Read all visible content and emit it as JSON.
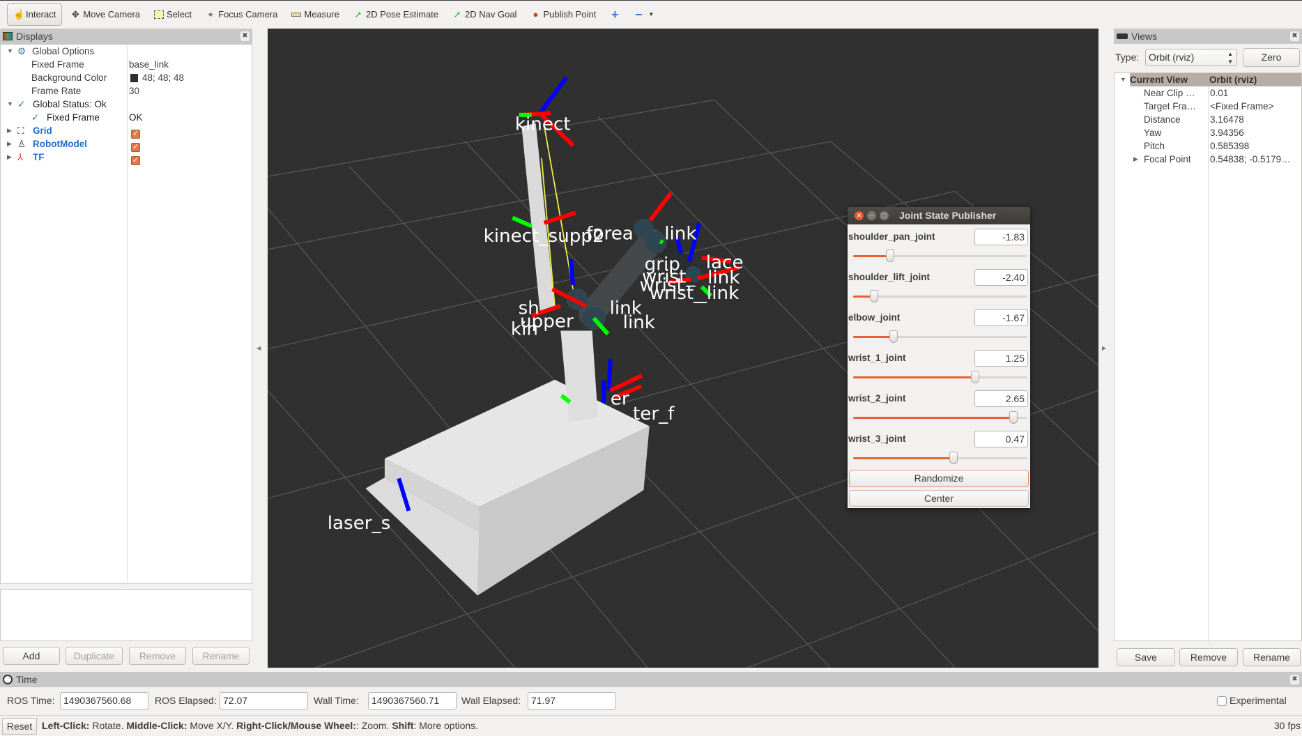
{
  "toolbar": {
    "items": [
      {
        "label": "Interact",
        "icon": "hand-pointer-icon",
        "active": true
      },
      {
        "label": "Move Camera",
        "icon": "move-camera-icon"
      },
      {
        "label": "Select",
        "icon": "select-rect-icon"
      },
      {
        "label": "Focus Camera",
        "icon": "focus-camera-icon"
      },
      {
        "label": "Measure",
        "icon": "ruler-icon"
      },
      {
        "label": "2D Pose Estimate",
        "icon": "green-arrow-icon"
      },
      {
        "label": "2D Nav Goal",
        "icon": "green-arrow-icon"
      },
      {
        "label": "Publish Point",
        "icon": "map-pin-icon"
      }
    ]
  },
  "displays": {
    "title": "Displays",
    "global_options": "Global Options",
    "fixed_frame_label": "Fixed Frame",
    "fixed_frame_value": "base_link",
    "bg_color_label": "Background Color",
    "bg_color_value": "48; 48; 48",
    "bg_color_swatch": "#303030",
    "frame_rate_label": "Frame Rate",
    "frame_rate_value": "30",
    "global_status": "Global Status: Ok",
    "status_fixed_frame_label": "Fixed Frame",
    "status_fixed_frame_value": "OK",
    "items": [
      {
        "label": "Grid",
        "checked": true
      },
      {
        "label": "RobotModel",
        "checked": true
      },
      {
        "label": "TF",
        "checked": true
      }
    ],
    "buttons": {
      "add": "Add",
      "duplicate": "Duplicate",
      "remove": "Remove",
      "rename": "Rename"
    }
  },
  "views": {
    "title": "Views",
    "type_label": "Type:",
    "type_value": "Orbit (rviz)",
    "zero": "Zero",
    "current_view": "Current View",
    "current_view_value": "Orbit (rviz)",
    "props": [
      {
        "label": "Near Clip …",
        "value": "0.01"
      },
      {
        "label": "Target Fra…",
        "value": "<Fixed Frame>"
      },
      {
        "label": "Distance",
        "value": "3.16478"
      },
      {
        "label": "Yaw",
        "value": "3.94356"
      },
      {
        "label": "Pitch",
        "value": "0.585398"
      },
      {
        "label": "Focal Point",
        "value": "0.54838; -0.5179…"
      }
    ],
    "buttons": {
      "save": "Save",
      "remove": "Remove",
      "rename": "Rename"
    }
  },
  "time": {
    "title": "Time",
    "ros_time_label": "ROS Time:",
    "ros_time": "1490367560.68",
    "ros_elapsed_label": "ROS Elapsed:",
    "ros_elapsed": "72.07",
    "wall_time_label": "Wall Time:",
    "wall_time": "1490367560.71",
    "wall_elapsed_label": "Wall Elapsed:",
    "wall_elapsed": "71.97",
    "experimental": "Experimental"
  },
  "status": {
    "reset": "Reset",
    "hint": [
      {
        "b": "Left-Click:",
        "t": " Rotate. "
      },
      {
        "b": "Middle-Click:",
        "t": " Move X/Y. "
      },
      {
        "b": "Right-Click/Mouse Wheel:",
        "t": ": Zoom. "
      },
      {
        "b": "Shift",
        "t": ": More options."
      }
    ],
    "fps": "30 fps"
  },
  "scene": {
    "labels": [
      "kinect",
      "kinect_supp2",
      "forea",
      "link",
      "grip",
      "lace",
      "link",
      "wrist_",
      "wrist",
      "wrist_",
      "_link",
      "sh",
      "link",
      "upper",
      "link",
      "kin",
      "er",
      "ter_f",
      "laser_s"
    ]
  },
  "jsp": {
    "title": "Joint State Publisher",
    "joints": [
      {
        "name": "shoulder_pan_joint",
        "value": "-1.83",
        "fraction": 0.21
      },
      {
        "name": "shoulder_lift_joint",
        "value": "-2.40",
        "fraction": 0.12
      },
      {
        "name": "elbow_joint",
        "value": "-1.67",
        "fraction": 0.23
      },
      {
        "name": "wrist_1_joint",
        "value": "1.25",
        "fraction": 0.7
      },
      {
        "name": "wrist_2_joint",
        "value": "2.65",
        "fraction": 0.92
      },
      {
        "name": "wrist_3_joint",
        "value": "0.47",
        "fraction": 0.575
      }
    ],
    "randomize": "Randomize",
    "center": "Center"
  },
  "colors": {
    "accent": "#e8602c",
    "viewport_bg": "#303030",
    "link_blue": "#1a6fd0"
  }
}
